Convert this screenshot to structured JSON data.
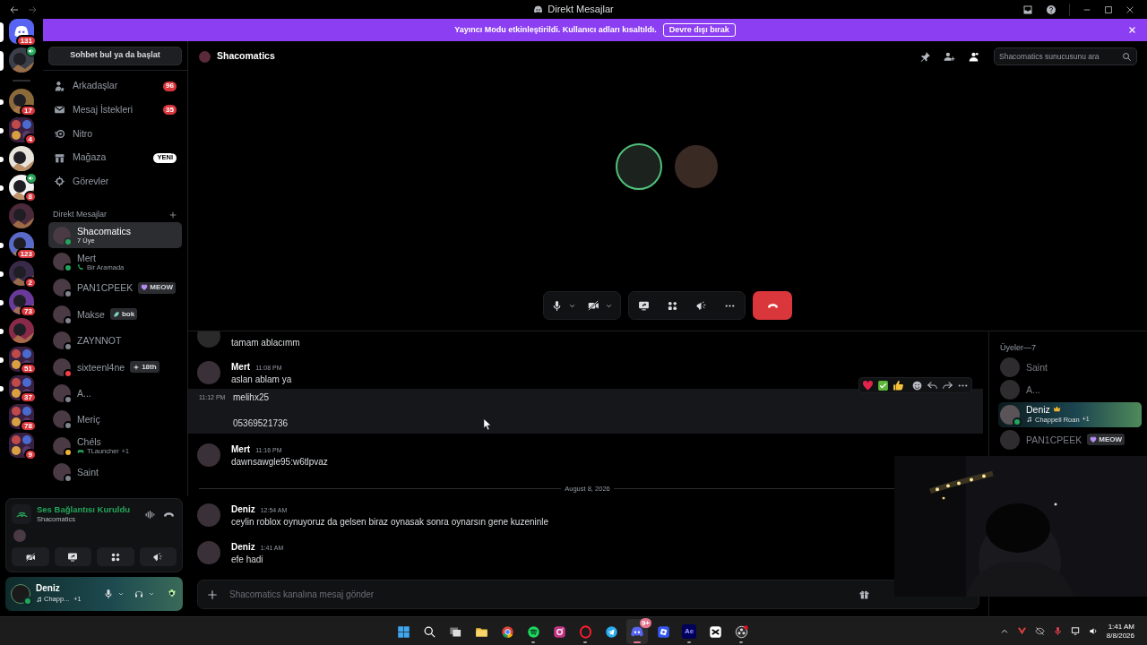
{
  "window": {
    "title": "Direkt Mesajlar"
  },
  "banner": {
    "text": "Yayıncı Modu etkinleştirildi. Kullanıcı adları kısaltıldı.",
    "button": "Devre dışı bırak"
  },
  "servers": [
    {
      "kind": "home",
      "badge": "131",
      "selected": true,
      "unread": false,
      "voice": false
    },
    {
      "kind": "server",
      "selected": true,
      "unread": false,
      "voice": true
    },
    {
      "kind": "separator"
    },
    {
      "kind": "server",
      "badge": "17",
      "selected": false,
      "unread": true,
      "voice": false
    },
    {
      "kind": "folder",
      "badge": "4",
      "selected": false,
      "unread": true,
      "voice": false
    },
    {
      "kind": "server",
      "selected": false,
      "unread": true,
      "voice": false
    },
    {
      "kind": "server",
      "badge": "8",
      "selected": false,
      "unread": true,
      "voice": true
    },
    {
      "kind": "server",
      "selected": false,
      "unread": false,
      "voice": false
    },
    {
      "kind": "server",
      "badge": "123",
      "selected": false,
      "unread": true,
      "voice": false
    },
    {
      "kind": "server",
      "badge": "2",
      "selected": false,
      "unread": true,
      "voice": false
    },
    {
      "kind": "server",
      "badge": "73",
      "selected": false,
      "unread": true,
      "voice": false
    },
    {
      "kind": "server",
      "selected": false,
      "unread": true,
      "voice": false
    },
    {
      "kind": "folder",
      "badge": "51",
      "selected": false,
      "unread": true,
      "voice": false
    },
    {
      "kind": "folder",
      "badge": "37",
      "selected": false,
      "unread": true,
      "voice": false
    },
    {
      "kind": "folder",
      "badge": "78",
      "selected": false,
      "unread": false,
      "voice": false
    },
    {
      "kind": "folder",
      "badge": "9",
      "selected": false,
      "unread": false,
      "voice": false
    }
  ],
  "search_button": "Sohbet bul ya da başlat",
  "nav": [
    {
      "kind": "friends",
      "label": "Arkadaşlar",
      "count": "96"
    },
    {
      "kind": "requests",
      "label": "Mesaj İstekleri",
      "count": "35"
    },
    {
      "kind": "nitro",
      "label": "Nitro"
    },
    {
      "kind": "shop",
      "label": "Mağaza",
      "tag": "YENİ"
    },
    {
      "kind": "quests",
      "label": "Görevler"
    }
  ],
  "dm_header": "Direkt Mesajlar",
  "dms": [
    {
      "name": "Shacomatics",
      "subtitle": "7 Üye",
      "color": "#23a55a",
      "selected": true
    },
    {
      "name": "Mert",
      "activity": {
        "kind": "call",
        "text": "Bir Aramada"
      },
      "color": "#23a55a",
      "selected": false
    },
    {
      "name": "PAN1CPEEK",
      "tag": {
        "kind": "heart",
        "text": "MEOW"
      },
      "color": "#80848e",
      "selected": false
    },
    {
      "name": "Makse",
      "tag": {
        "kind": "leaf",
        "text": "bok"
      },
      "color": "#80848e",
      "selected": false
    },
    {
      "name": "ZAYNNOT",
      "color": "#80848e",
      "selected": false
    },
    {
      "name": "sixteenl4ne",
      "tag": {
        "kind": "star",
        "text": "18th"
      },
      "color": "#f23f43",
      "selected": false
    },
    {
      "name": "A...",
      "color": "#80848e",
      "selected": false
    },
    {
      "name": "Meriç",
      "color": "#80848e",
      "selected": false
    },
    {
      "name": "Chéls",
      "activity": {
        "kind": "game",
        "text": "TLauncher",
        "extra": "+1"
      },
      "color": "#f0b232",
      "selected": false
    },
    {
      "name": "Saint",
      "color": "#80848e",
      "selected": false
    }
  ],
  "voice": {
    "status": "Ses Bağlantısı Kuruldu",
    "channel": "Shacomatics"
  },
  "user": {
    "name": "Deniz",
    "activity": "Chapp...",
    "extra": "+1",
    "color": "#23a55a"
  },
  "channel": {
    "name": "Shacomatics",
    "search_placeholder": "Shacomatics sunucusunu ara"
  },
  "call": {
    "participants": [
      {
        "speaking": true
      },
      {
        "speaking": false
      }
    ]
  },
  "messages": [
    {
      "kind": "cut",
      "text": "tamam ablacımm",
      "hovered": false
    },
    {
      "kind": "message",
      "author": "Mert",
      "time": "11:08 PM",
      "text": "aslan ablam ya",
      "hovered": false
    },
    {
      "kind": "continuation",
      "time": "11:12 PM",
      "text": "melihx25\n\n05369521736",
      "hovered": true
    },
    {
      "kind": "message",
      "author": "Mert",
      "time": "11:16 PM",
      "text": "dawnsawgle95:w6tlpvaz",
      "hovered": false
    },
    {
      "kind": "divider",
      "text": "August 8, 2026"
    },
    {
      "kind": "message",
      "author": "Deniz",
      "time": "12:54 AM",
      "text": "ceylin roblox oynuyoruz da gelsen biraz oynasak sonra oynarsın gene kuzeninle",
      "hovered": false
    },
    {
      "kind": "message",
      "author": "Deniz",
      "time": "1:41 AM",
      "text": "efe hadi",
      "hovered": false
    }
  ],
  "composer": {
    "placeholder": "Shacomatics kanalına mesaj gönder"
  },
  "members": {
    "header": "Üyeler—7",
    "items": [
      {
        "name": "Saint",
        "offline": true,
        "owner": false,
        "highlighted": false
      },
      {
        "name": "A...",
        "offline": true,
        "owner": false,
        "highlighted": false
      },
      {
        "name": "Deniz",
        "offline": false,
        "owner": true,
        "highlighted": true,
        "color": "#23a55a",
        "activity": "Chappell Roan",
        "extra": "+1"
      },
      {
        "name": "PAN1CPEEK",
        "offline": true,
        "owner": false,
        "highlighted": false,
        "tag": {
          "kind": "heart",
          "text": "MEOW"
        }
      }
    ]
  },
  "taskbar": {
    "apps": [
      {
        "kind": "windows",
        "open": false,
        "focused": false
      },
      {
        "kind": "search",
        "open": false,
        "focused": false
      },
      {
        "kind": "taskview",
        "open": false,
        "focused": false
      },
      {
        "kind": "files",
        "open": false,
        "focused": false
      },
      {
        "kind": "chrome",
        "open": false,
        "focused": false
      },
      {
        "kind": "spotify",
        "open": true,
        "focused": false
      },
      {
        "kind": "instagram",
        "open": false,
        "focused": false
      },
      {
        "kind": "opera",
        "open": true,
        "focused": false
      },
      {
        "kind": "telegram",
        "open": false,
        "focused": false
      },
      {
        "kind": "discord",
        "open": true,
        "focused": true,
        "badge": "9+"
      },
      {
        "kind": "roblox",
        "open": false,
        "focused": false
      },
      {
        "kind": "ae",
        "label": "Ae",
        "open": true,
        "focused": false
      },
      {
        "kind": "capcut",
        "open": false,
        "focused": false
      },
      {
        "kind": "obs",
        "open": true,
        "focused": false
      }
    ],
    "time": "1:41 AM",
    "date": "8/8/2026"
  }
}
